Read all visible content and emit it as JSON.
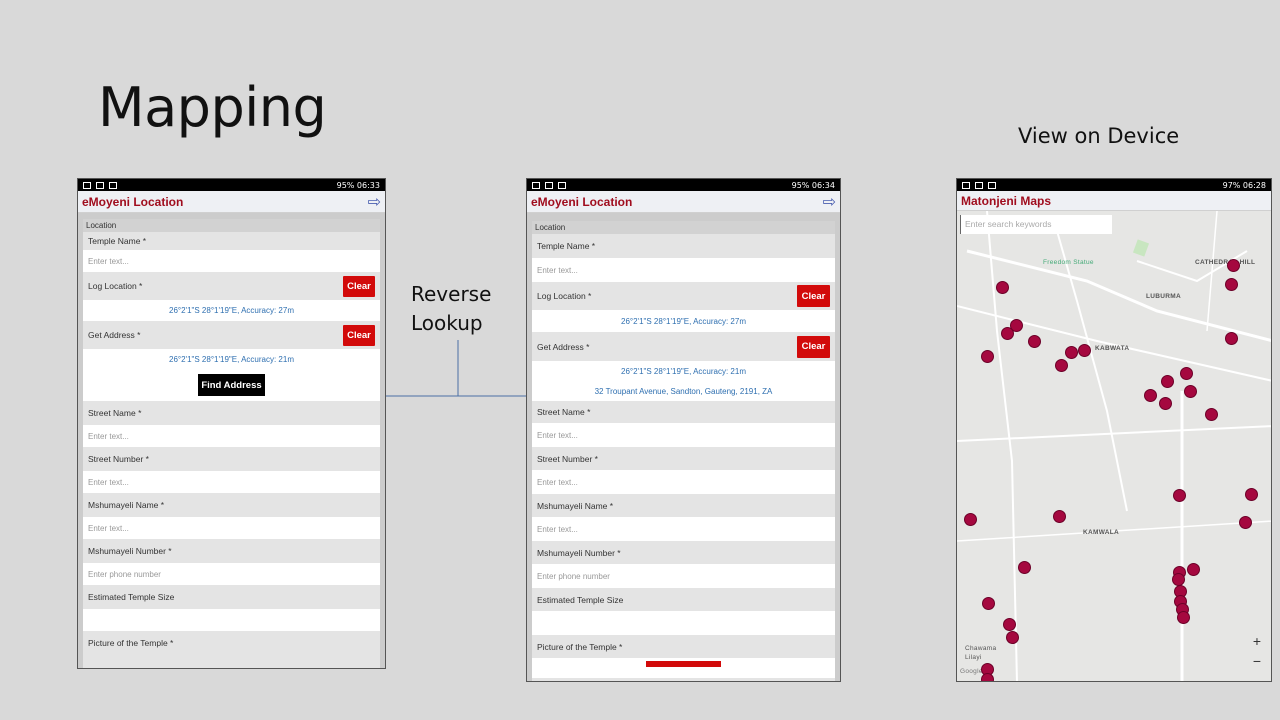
{
  "slide": {
    "title": "Mapping",
    "view_label": "View on Device",
    "reverse_label_1": "Reverse",
    "reverse_label_2": "Lookup"
  },
  "phone1": {
    "status": "95% 06:33",
    "app_title": "eMoyeni Location",
    "section": "Location",
    "temple_name_label": "Temple Name *",
    "placeholder": "Enter text...",
    "log_location_label": "Log Location *",
    "clear": "Clear",
    "log_value": "26°2'1\"S 28°1'19\"E, Accuracy: 27m",
    "get_address_label": "Get Address *",
    "get_value": "26°2'1\"S 28°1'19\"E, Accuracy: 21m",
    "find_address": "Find Address",
    "street_name_label": "Street Name *",
    "street_number_label": "Street Number *",
    "msh_name_label": "Mshumayeli Name *",
    "msh_number_label": "Mshumayeli Number *",
    "phone_placeholder": "Enter phone number",
    "temple_size_label": "Estimated Temple Size",
    "picture_label": "Picture of the Temple *"
  },
  "phone2": {
    "status": "95% 06:34",
    "app_title": "eMoyeni Location",
    "section": "Location",
    "temple_name_label": "Temple Name *",
    "placeholder": "Enter text...",
    "log_location_label": "Log Location *",
    "clear": "Clear",
    "log_value": "26°2'1\"S 28°1'19\"E, Accuracy: 27m",
    "get_address_label": "Get Address *",
    "get_value": "26°2'1\"S 28°1'19\"E, Accuracy: 21m",
    "address_value": "32 Troupant Avenue, Sandton, Gauteng, 2191, ZA",
    "street_name_label": "Street Name *",
    "street_number_label": "Street Number *",
    "msh_name_label": "Mshumayeli Name *",
    "msh_number_label": "Mshumayeli Number *",
    "phone_placeholder": "Enter phone number",
    "temple_size_label": "Estimated Temple Size",
    "picture_label": "Picture of the Temple *"
  },
  "phone3": {
    "status": "97% 06:28",
    "app_title": "Matonjeni Maps",
    "search_placeholder": "Enter search keywords",
    "places": {
      "freedom": "Freedom Statue",
      "cathedral": "CATHEDRAL HILL",
      "luburma": "LUBURMA",
      "kabwata": "KABWATA",
      "kamwala": "KAMWALA",
      "chawama": "Chawama",
      "lilayi": "Lilayi",
      "google": "Google"
    },
    "zoom_in": "+",
    "zoom_out": "−"
  },
  "colors": {
    "accent": "#a00d1e",
    "marker": "#a5083f",
    "clear_button": "#d20a0a",
    "link_value": "#2e6fb0"
  }
}
